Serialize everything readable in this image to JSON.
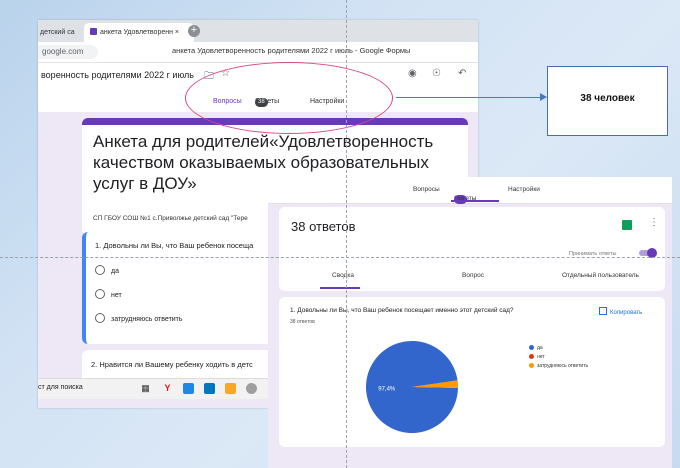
{
  "browser": {
    "tab1_label": "детский са",
    "tab2_label": "анкета Удовлетворенн ×",
    "new_tab": "+",
    "address_host": "google.com",
    "window_title": "анкета Удовлетворенность родителями 2022 г июль - Google Формы"
  },
  "form_header": {
    "doc_name": "воренность родителями 2022 г июль",
    "tabs": {
      "questions": "Вопросы",
      "answers": "Ответы",
      "answers_count": "38",
      "settings": "Настройки"
    }
  },
  "form": {
    "title": "Анкета для родителей«Удовлетворенность качеством оказываемых образовательных услуг в ДОУ»",
    "subtitle": "СП ГБОУ СОШ №1 с.Приволжье детский сад \"Тере",
    "q1": {
      "text": "1. Довольны ли Вы, что Ваш ребенок посеща",
      "options": [
        "да",
        "нет",
        "затрудняюсь ответить"
      ]
    },
    "q2": {
      "text": "2. Нравится ли Вашему ребенку ходить в детс"
    }
  },
  "taskbar": {
    "search": "ст для поиска",
    "y_label": "Y"
  },
  "callout": {
    "text": "38 человек"
  },
  "responses": {
    "tabs": {
      "questions": "Вопросы",
      "answers": "Ответы",
      "answers_count": "38",
      "settings": "Настройки"
    },
    "count_title": "38 ответов",
    "accept_label": "Принимать ответы",
    "sub_tabs": {
      "summary": "Сводка",
      "question": "Вопрос",
      "individual": "Отдельный пользователь"
    },
    "q1_text": "1. Довольны ли Вы, что Ваш ребенок посещает именно этот детский сад?",
    "q1_count": "38 ответов",
    "copy_label": "Копировать"
  },
  "chart_data": {
    "type": "pie",
    "categories": [
      "да",
      "нет",
      "затрудняюсь ответить"
    ],
    "values": [
      97.4,
      0,
      2.6
    ],
    "data_labels": [
      "97,4%",
      "",
      ""
    ],
    "colors": [
      "#3366cc",
      "#dc3912",
      "#ff9900"
    ],
    "legend": "right"
  },
  "colors": {
    "accent": "#673ab7",
    "annotation": "#d9488b",
    "arrow": "#4a78c4"
  }
}
